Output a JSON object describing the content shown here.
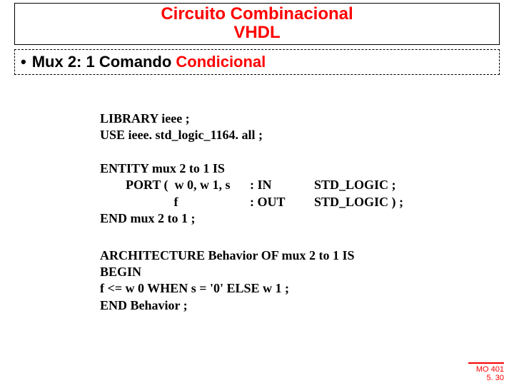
{
  "title": {
    "line1": "Circuito Combinacional",
    "line2": "VHDL"
  },
  "subtitle": {
    "bullet": "•",
    "black1": "Mux 2: 1 Comando ",
    "red1": "Condicional"
  },
  "code": {
    "l1": "LIBRARY ieee ;",
    "l2": "USE ieee. std_logic_1164. all ;",
    "l3": "ENTITY mux 2 to 1 IS",
    "l4a": "        PORT (  w 0, w 1, s",
    "l4b": ": IN",
    "l4c": "STD_LOGIC ;",
    "l5a": "                       f",
    "l5b": ": OUT",
    "l5c": "STD_LOGIC ) ;",
    "l6": "END mux 2 to 1 ;"
  },
  "arch": {
    "l1": "ARCHITECTURE Behavior OF mux 2 to 1 IS",
    "l2": "BEGIN",
    "l3": "        f <= w 0 WHEN s = '0' ELSE w 1 ;",
    "l4": "END Behavior ;"
  },
  "footer": {
    "course": "MO 401",
    "page": "5. 30"
  }
}
